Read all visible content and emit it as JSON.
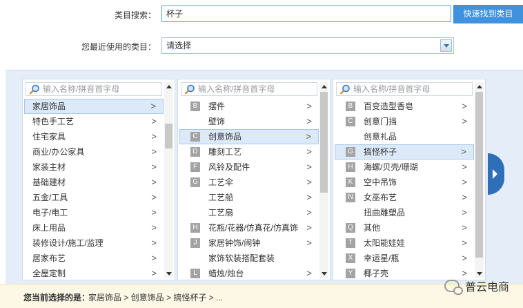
{
  "search": {
    "label": "类目搜索：",
    "value": "杯子",
    "button": "快速找到类目"
  },
  "recent": {
    "label": "您最近使用的类目：",
    "selected": "请选择"
  },
  "filter_placeholder": "输入名称/拼音首字母",
  "col1": [
    {
      "label": "家居饰品",
      "chev": ">",
      "selected": true
    },
    {
      "label": "特色手工艺",
      "chev": ">"
    },
    {
      "label": "住宅家具",
      "chev": ">"
    },
    {
      "label": "商业/办公家具",
      "chev": ">"
    },
    {
      "label": "家装主材",
      "chev": ">"
    },
    {
      "label": "基础建材",
      "chev": ">"
    },
    {
      "label": "五金/工具",
      "chev": ">"
    },
    {
      "label": "电子/电工",
      "chev": ">"
    },
    {
      "label": "床上用品",
      "chev": ">"
    },
    {
      "label": "装修设计/施工/监理",
      "chev": ">"
    },
    {
      "label": "居家布艺",
      "chev": ">"
    },
    {
      "label": "全屋定制",
      "chev": ">"
    }
  ],
  "col2": [
    {
      "badge": "B",
      "label": "摆件",
      "chev": ">"
    },
    {
      "badge": "",
      "label": "壁饰",
      "chev": ">"
    },
    {
      "badge": "C",
      "label": "创意饰品",
      "chev": ">",
      "selected": true
    },
    {
      "badge": "D",
      "label": "雕刻工艺",
      "chev": ">"
    },
    {
      "badge": "F",
      "label": "风铃及配件",
      "chev": ">"
    },
    {
      "badge": "G",
      "label": "工艺伞",
      "chev": ">"
    },
    {
      "badge": "",
      "label": "工艺船",
      "chev": ">"
    },
    {
      "badge": "",
      "label": "工艺扇",
      "chev": ">"
    },
    {
      "badge": "H",
      "label": "花瓶/花器/仿真花/仿真饰",
      "chev": ">"
    },
    {
      "badge": "J",
      "label": "家居钟饰/闹钟",
      "chev": ">"
    },
    {
      "badge": "",
      "label": "家饰软装搭配套装",
      "chev": ""
    },
    {
      "badge": "L",
      "label": "蜡烛/烛台",
      "chev": ">"
    }
  ],
  "col3": [
    {
      "badge": "B",
      "label": "百变造型香皂",
      "chev": ">"
    },
    {
      "badge": "C",
      "label": "创意门挡",
      "chev": ">"
    },
    {
      "badge": "",
      "label": "创意礼品",
      "chev": ""
    },
    {
      "badge": "G",
      "label": "搞怪杯子",
      "chev": ">",
      "selected": true
    },
    {
      "badge": "H",
      "label": "海螺/贝壳/珊瑚",
      "chev": ">"
    },
    {
      "badge": "K",
      "label": "空中吊饰",
      "chev": ">"
    },
    {
      "badge": "N",
      "label": "女巫布艺",
      "chev": ">"
    },
    {
      "badge": "",
      "label": "扭曲雕塑品",
      "chev": ">"
    },
    {
      "badge": "Q",
      "label": "其他",
      "chev": ">"
    },
    {
      "badge": "T",
      "label": "太阳能娃娃",
      "chev": ">"
    },
    {
      "badge": "X",
      "label": "幸运星/瓶",
      "chev": ">"
    },
    {
      "badge": "Y",
      "label": "椰子壳",
      "chev": ">"
    }
  ],
  "bottom": {
    "label": "您当前选择的是：",
    "path": "家居饰品 > 创意饰品 > 搞怪杯子 > ...",
    "watermark": "普云电商"
  },
  "colors": {
    "accent": "#3e92de",
    "selected_bg": "#dbe9f8",
    "panel_bg": "#e5eef8",
    "next_arrow": "#2f6fb7",
    "bottom_bg": "#fdf8e6"
  },
  "icons": [
    "search-icon",
    "chevron-right-icon",
    "scroll-up-icon",
    "scroll-down-icon",
    "next-arrow-icon",
    "wechat-icon"
  ]
}
